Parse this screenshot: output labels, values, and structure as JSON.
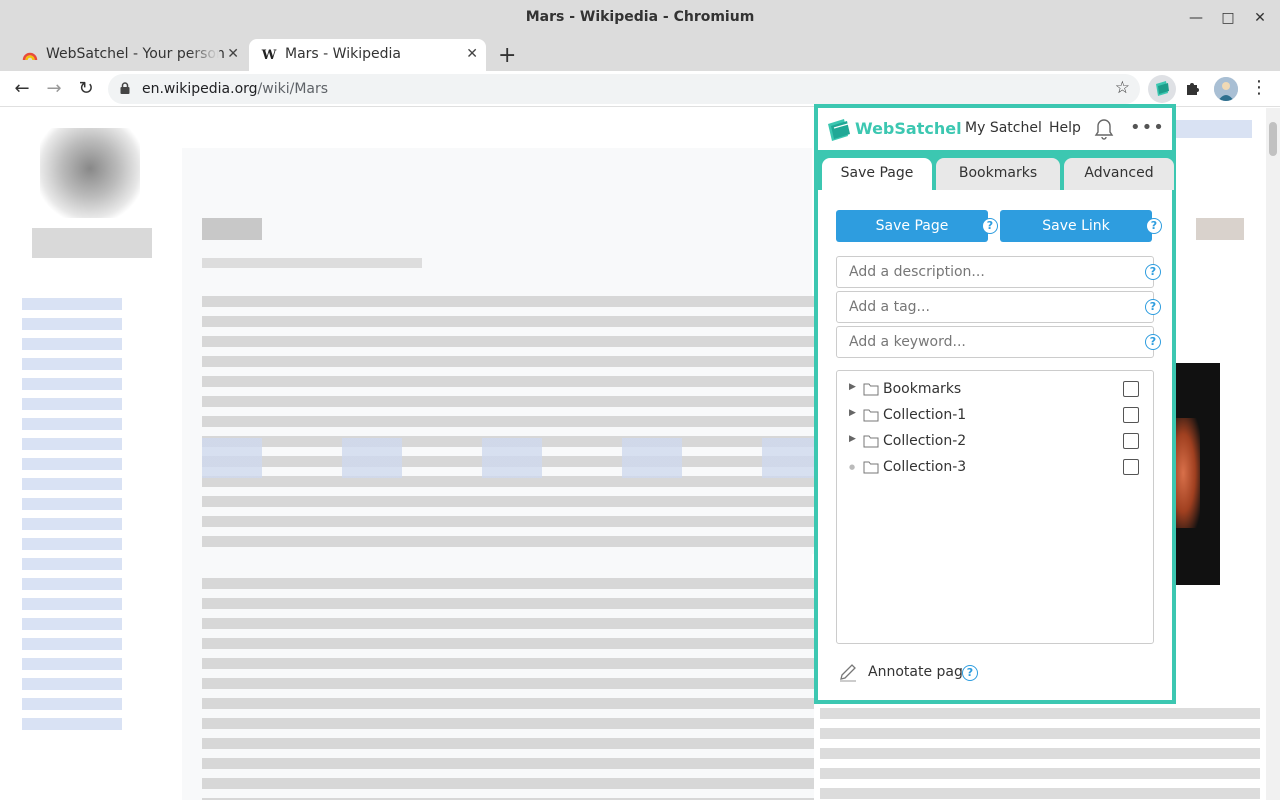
{
  "window": {
    "title": "Mars - Wikipedia - Chromium"
  },
  "tabs": [
    {
      "title": "WebSatchel - Your person",
      "favicon": "websatchel-favicon"
    },
    {
      "title": "Mars - Wikipedia",
      "favicon": "wikipedia-w-icon"
    }
  ],
  "address_bar": {
    "domain": "en.wikipedia.org",
    "path": "/wiki/Mars"
  },
  "extension": {
    "brand": "WebSatchel",
    "nav": {
      "my_satchel": "My Satchel",
      "help": "Help",
      "more": "•••"
    },
    "tabs": [
      "Save Page",
      "Bookmarks",
      "Advanced"
    ],
    "active_tab": "Save Page",
    "buttons": {
      "save_page": "Save Page",
      "save_link": "Save Link"
    },
    "help_glyph": "?",
    "inputs": {
      "description_placeholder": "Add a description...",
      "tag_placeholder": "Add a tag...",
      "keyword_placeholder": "Add a keyword..."
    },
    "collections": [
      {
        "label": "Bookmarks",
        "expandable": true,
        "checked": false
      },
      {
        "label": "Collection-1",
        "expandable": true,
        "checked": false
      },
      {
        "label": "Collection-2",
        "expandable": true,
        "checked": false
      },
      {
        "label": "Collection-3",
        "expandable": false,
        "checked": false
      }
    ],
    "annotate_label": "Annotate page",
    "colors": {
      "accent": "#3cc7b1",
      "button": "#2e9ddf"
    }
  }
}
